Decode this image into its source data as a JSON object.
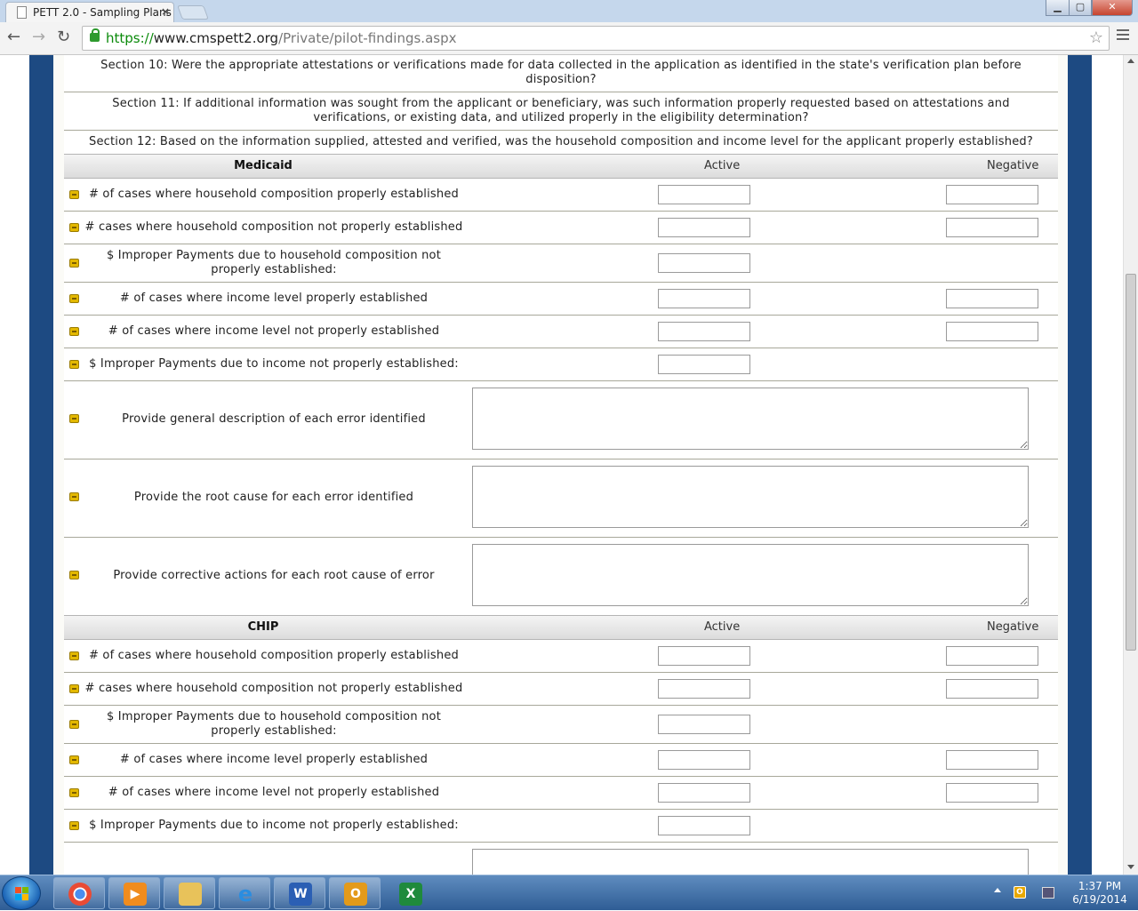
{
  "browser": {
    "tab_title": "PETT 2.0 - Sampling Plans",
    "tab_close": "×",
    "url_scheme": "https://",
    "url_host": "www.cmspett2.org",
    "url_path": "/Private/pilot-findings.aspx",
    "back_glyph": "←",
    "forward_glyph": "→",
    "reload_glyph": "↻",
    "star_glyph": "☆",
    "min_glyph": "▁",
    "max_glyph": "▢",
    "close_glyph": "✕"
  },
  "sections": [
    {
      "text": "Section 10: Were the appropriate attestations or verifications made for data collected in the application as identified in the state's verification plan before disposition?"
    },
    {
      "text": "Section 11: If additional information was sought from the applicant or beneficiary, was such information properly requested based on attestations and verifications, or existing data, and utilized properly in the eligibility determination?"
    },
    {
      "text": "Section 12: Based on the information supplied, attested and verified, was the household composition and income level for the applicant properly established?"
    }
  ],
  "medicaid": {
    "group_label": "Medicaid",
    "active_label": "Active",
    "negative_label": "Negative",
    "rows": [
      {
        "label": "# of cases where household composition properly established",
        "active_value": "",
        "negative_value": ""
      },
      {
        "label": "# cases where household composition not properly established",
        "active_value": "",
        "negative_value": ""
      },
      {
        "label": "$ Improper Payments due to household composition not properly established:",
        "active_value": ""
      },
      {
        "label": "# of cases where income level properly established",
        "active_value": "",
        "negative_value": ""
      },
      {
        "label": "# of cases where income level not properly established",
        "active_value": "",
        "negative_value": ""
      },
      {
        "label": "$ Improper Payments due to income not properly established:",
        "active_value": ""
      },
      {
        "label": "Provide general description of each error identified",
        "text_value": ""
      },
      {
        "label": "Provide the root cause for each error identified",
        "text_value": ""
      },
      {
        "label": "Provide corrective actions for each root cause of error",
        "text_value": ""
      }
    ]
  },
  "chip": {
    "group_label": "CHIP",
    "active_label": "Active",
    "negative_label": "Negative",
    "rows": [
      {
        "label": "# of cases where household composition properly established",
        "active_value": "",
        "negative_value": ""
      },
      {
        "label": "# cases where household composition not properly established",
        "active_value": "",
        "negative_value": ""
      },
      {
        "label": "$ Improper Payments due to household composition not properly established:",
        "active_value": ""
      },
      {
        "label": "# of cases where income level properly established",
        "active_value": "",
        "negative_value": ""
      },
      {
        "label": "# of cases where income level not properly established",
        "active_value": "",
        "negative_value": ""
      },
      {
        "label": "$ Improper Payments due to income not properly established:",
        "active_value": ""
      },
      {
        "text_value": ""
      }
    ]
  },
  "taskbar": {
    "items": [
      "chrome-icon",
      "media-player-icon",
      "explorer-icon",
      "internet-explorer-icon",
      "word-icon",
      "outlook-icon",
      "excel-icon"
    ],
    "word_glyph": "W",
    "outlook_glyph": "O",
    "excel_glyph": "X",
    "ie_glyph": "e",
    "tray_outlook_glyph": "O",
    "time": "1:37 PM",
    "date": "6/19/2014"
  },
  "colors": {
    "frame_blue": "#1d4a82",
    "bullet_yellow": "#e3b800",
    "url_green": "#0a8a0a"
  }
}
